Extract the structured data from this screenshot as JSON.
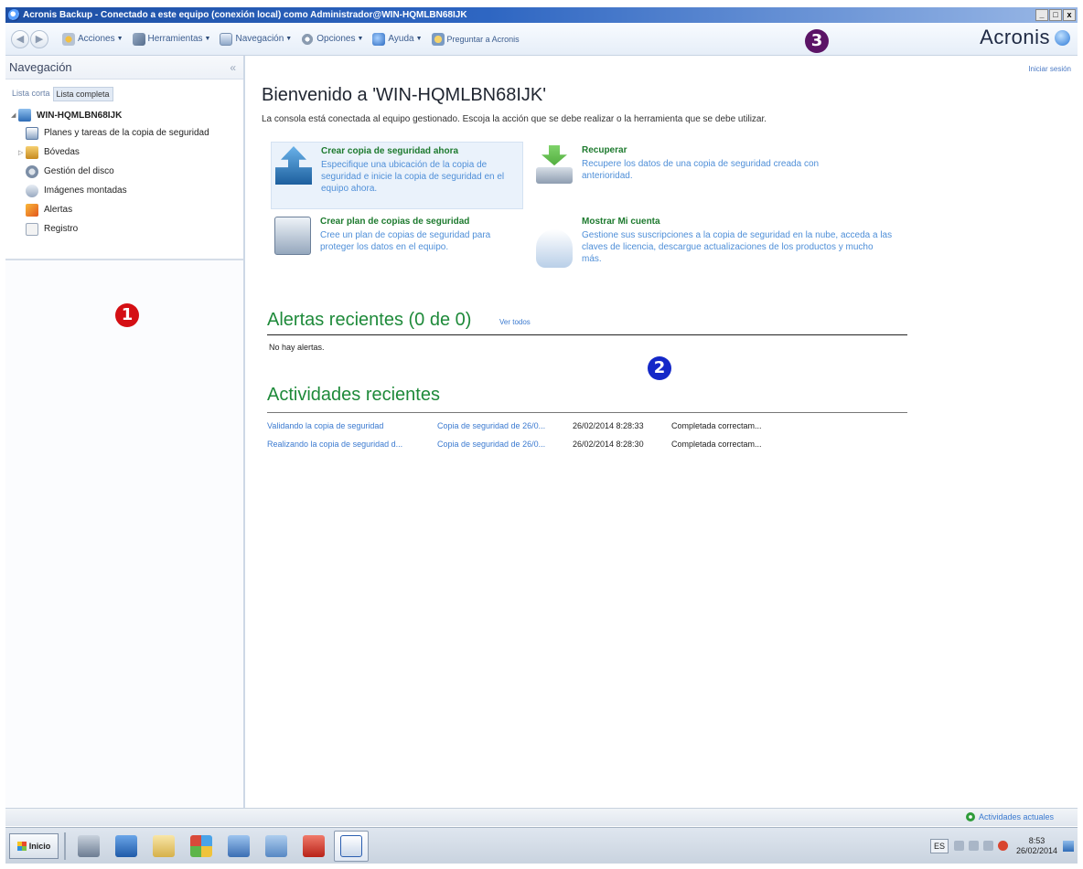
{
  "window": {
    "title": "Acronis Backup - Conectado a este equipo (conexión local) como Administrador@WIN-HQMLBN68IJK",
    "buttons": [
      "_",
      "□",
      "x"
    ]
  },
  "toolbar": {
    "items": [
      {
        "label": "Acciones",
        "icon": "actions-icon"
      },
      {
        "label": "Herramientas",
        "icon": "tools-icon"
      },
      {
        "label": "Navegación",
        "icon": "navigation-icon"
      },
      {
        "label": "Opciones",
        "icon": "options-icon"
      },
      {
        "label": "Ayuda",
        "icon": "help-icon"
      }
    ],
    "ask": "Preguntar a Acronis",
    "brand": "Acronis"
  },
  "badges": {
    "one": "1",
    "two": "2",
    "three": "3"
  },
  "sidebar": {
    "title": "Navegación",
    "collapse": "«",
    "tab_short": "Lista corta",
    "tab_full": "Lista completa",
    "root": "WIN-HQMLBN68IJK",
    "items": [
      {
        "label": "Planes y tareas de la copia de seguridad"
      },
      {
        "label": "Bóvedas"
      },
      {
        "label": "Gestión del disco"
      },
      {
        "label": "Imágenes montadas"
      },
      {
        "label": "Alertas"
      },
      {
        "label": "Registro"
      }
    ]
  },
  "main": {
    "login": "Iniciar sesión",
    "welcome": "Bienvenido a 'WIN-HQMLBN68IJK'",
    "description": "La consola está conectada al equipo gestionado. Escoja la acción que se debe realizar o la herramienta que se debe utilizar.",
    "actions": {
      "backup": {
        "title": "Crear copia de seguridad ahora",
        "desc": "Especifique una ubicación de la copia de seguridad e inicie la copia de seguridad en el equipo ahora."
      },
      "recover": {
        "title": "Recuperar",
        "desc": "Recupere los datos de una copia de seguridad creada con anterioridad."
      },
      "plan": {
        "title": "Crear plan de copias de seguridad",
        "desc": "Cree un plan de copias de seguridad para proteger los datos en el equipo."
      },
      "account": {
        "title": "Mostrar Mi cuenta",
        "desc": "Gestione sus suscripciones a la copia de seguridad en la nube, acceda a las claves de licencia, descargue actualizaciones de los productos y mucho más."
      }
    },
    "alerts_title": "Alertas recientes (0 de 0)",
    "see_all": "Ver todos",
    "no_alerts": "No hay alertas.",
    "activities_title": "Actividades recientes",
    "activities": [
      {
        "name": "Validando la copia de seguridad",
        "plan": "Copia de seguridad de 26/0...",
        "date": "26/02/2014 8:28:33",
        "status": "Completada correctam..."
      },
      {
        "name": "Realizando la copia de seguridad d...",
        "plan": "Copia de seguridad de 26/0...",
        "date": "26/02/2014 8:28:30",
        "status": "Completada correctam..."
      }
    ]
  },
  "statusbar": {
    "current": "Actividades actuales"
  },
  "taskbar": {
    "start": "Inicio",
    "lang": "ES",
    "time": "8:53",
    "date": "26/02/2014"
  }
}
